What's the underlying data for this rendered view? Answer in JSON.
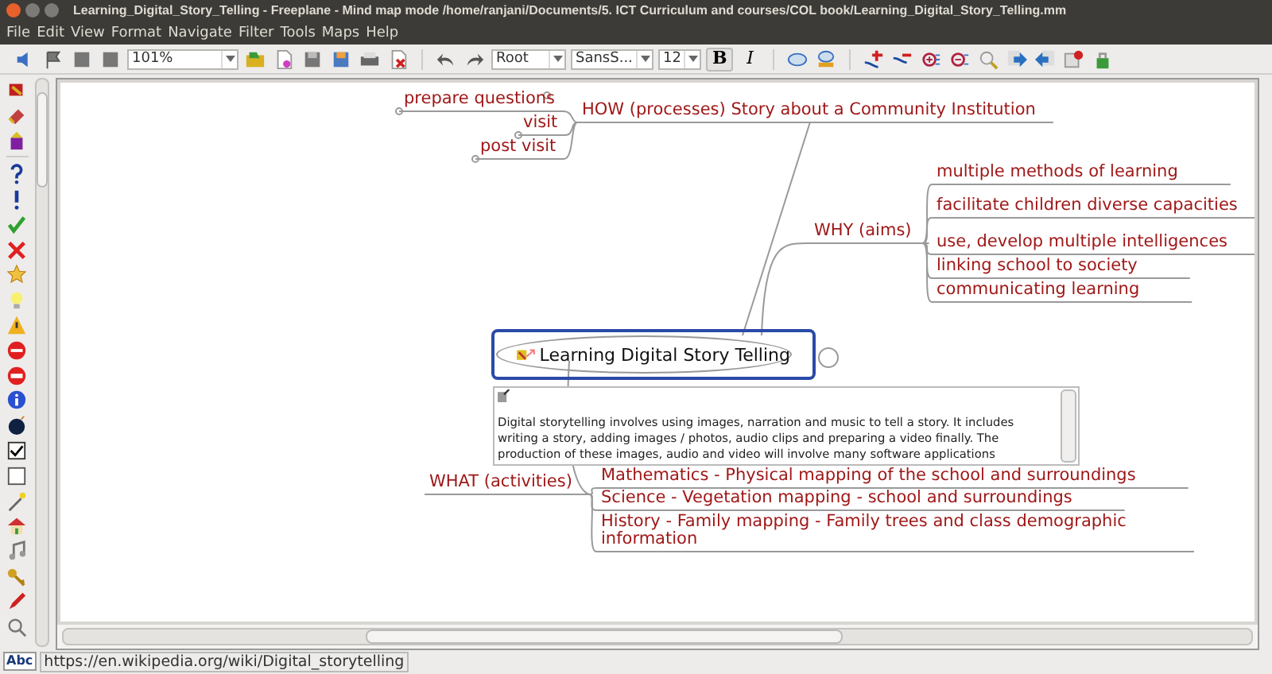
{
  "window": {
    "title": "Learning_Digital_Story_Telling - Freeplane - Mind map mode /home/ranjani/Documents/5. ICT Curriculum and courses/COL book/Learning_Digital_Story_Telling.mm"
  },
  "menu": [
    "File",
    "Edit",
    "View",
    "Format",
    "Navigate",
    "Filter",
    "Tools",
    "Maps",
    "Help"
  ],
  "toolbar": {
    "zoom": "101%",
    "style": "Root",
    "font": "SansS...",
    "size": "12",
    "bold": "B",
    "italic": "I"
  },
  "map": {
    "root": {
      "text": "Learning Digital Story Telling",
      "selected": true,
      "note": "Digital storytelling involves using images, narration and music to tell a story. It includes writing a story, adding images / photos, audio clips and preparing a video finally. The production of these images, audio and video will involve many software applications",
      "children": [
        {
          "text": "HOW (processes) Story about a Community Institution",
          "children": [
            {
              "text": "prepare questions"
            },
            {
              "text": "visit"
            },
            {
              "text": "post visit"
            }
          ]
        },
        {
          "text": "WHY (aims)",
          "children": [
            {
              "text": "multiple methods of learning"
            },
            {
              "text": "facilitate children diverse capacities"
            },
            {
              "text": "use, develop multiple intelligences"
            },
            {
              "text": "linking school to society"
            },
            {
              "text": "communicating learning"
            }
          ]
        },
        {
          "text": "WHAT (activities)",
          "children": [
            {
              "text": "Mathematics - Physical mapping of the school and surroundings"
            },
            {
              "text": "Science - Vegetation mapping - school and surroundings"
            },
            {
              "text": "History - Family mapping - Family trees and class demographic information"
            }
          ]
        }
      ]
    }
  },
  "status_bar": {
    "spell": "Abc",
    "link": "https://en.wikipedia.org/wiki/Digital_storytelling"
  }
}
